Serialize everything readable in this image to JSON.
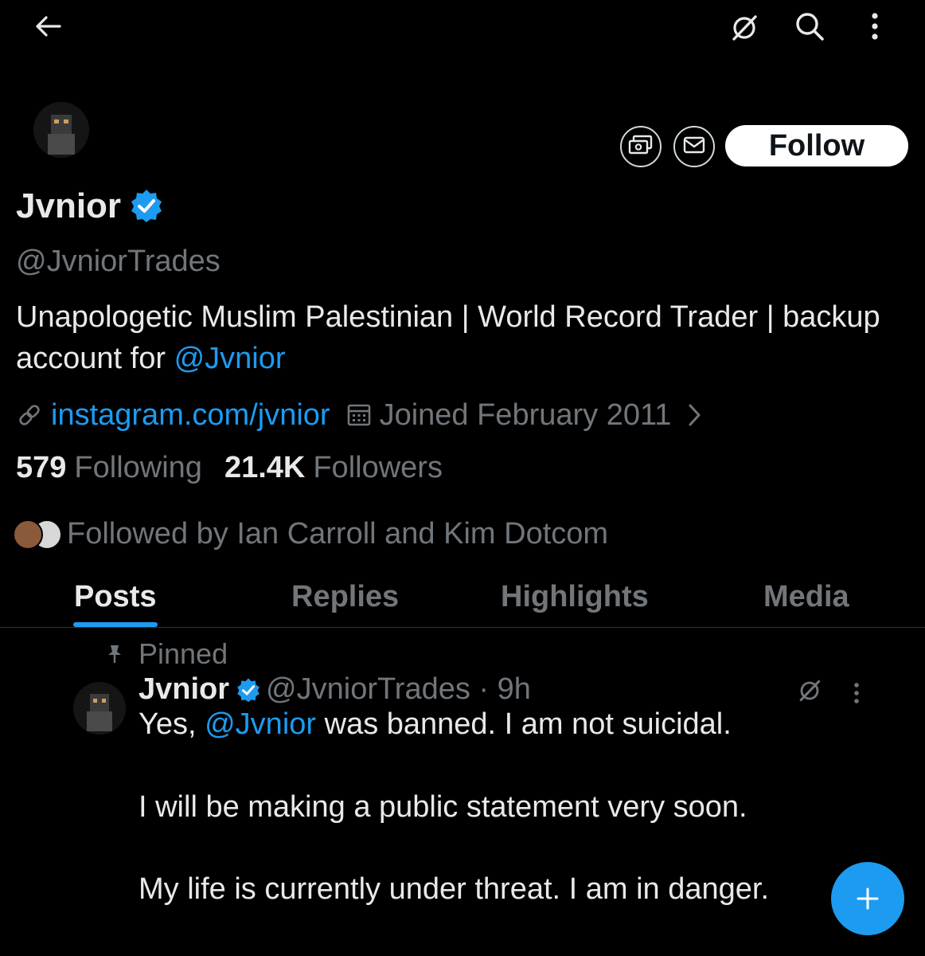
{
  "topbar": {
    "back_icon": "arrow-left-icon",
    "grok_icon": "grok-icon",
    "search_icon": "search-icon",
    "more_icon": "more-vertical-icon"
  },
  "profile": {
    "display_name": "Jvnior",
    "verified": true,
    "handle": "@JvniorTrades",
    "bio_text": "Unapologetic Muslim Palestinian | World Record Trader | backup account for ",
    "bio_mention": "@Jvnior",
    "website": "instagram.com/jvnior",
    "joined": "Joined February 2011",
    "following_count": "579",
    "following_label": "Following",
    "followers_count": "21.4K",
    "followers_label": "Followers",
    "followed_by": "Followed by Ian Carroll and Kim Dotcom"
  },
  "actions": {
    "tip_icon": "money-tip-icon",
    "message_icon": "envelope-icon",
    "follow_label": "Follow"
  },
  "tabs": [
    {
      "label": "Posts",
      "active": true
    },
    {
      "label": "Replies",
      "active": false
    },
    {
      "label": "Highlights",
      "active": false
    },
    {
      "label": "Media",
      "active": false
    }
  ],
  "pinned_post": {
    "pinned_label": "Pinned",
    "author_name": "Jvnior",
    "author_handle_time": "@JvniorTrades · 9h",
    "line1_before": "Yes, ",
    "line1_mention": "@Jvnior",
    "line1_after": " was banned. I am not suicidal.",
    "line2": "I will be making a public statement very soon.",
    "line3": "My life is currently under threat. I am in danger."
  },
  "fab": {
    "icon": "plus-icon"
  },
  "colors": {
    "background": "#000000",
    "accent": "#1d9bf0",
    "primary_text": "#e7e9ea",
    "secondary_text": "#71767b"
  }
}
